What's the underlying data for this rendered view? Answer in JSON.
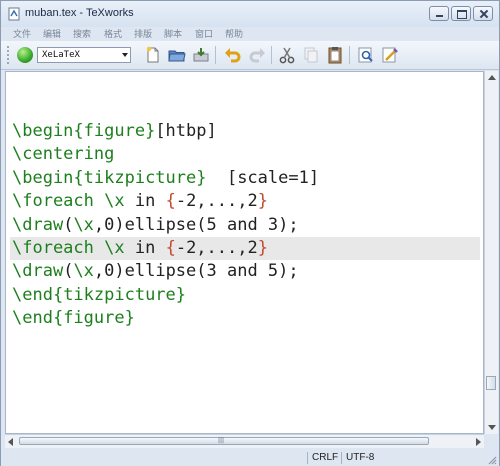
{
  "window": {
    "title": "muban.tex - TeXworks"
  },
  "menu": [
    "文件",
    "编辑",
    "搜索",
    "格式",
    "排版",
    "脚本",
    "窗口",
    "帮助"
  ],
  "toolbar": {
    "engine": "XeLaTeX",
    "icons": [
      "typeset-icon",
      "new-document-icon",
      "open-folder-icon",
      "save-icon",
      "undo-icon",
      "redo-icon",
      "cut-icon",
      "copy-icon",
      "paste-icon",
      "find-icon",
      "replace-icon"
    ]
  },
  "editor": {
    "lines": [
      [
        {
          "t": "\\begin",
          "c": "cmd"
        },
        {
          "t": "{figure}",
          "c": "arg"
        },
        {
          "t": "[htbp]",
          "c": "txt"
        }
      ],
      [
        {
          "t": "\\centering",
          "c": "cmd"
        }
      ],
      [
        {
          "t": "\\begin",
          "c": "cmd"
        },
        {
          "t": "{tikzpicture}",
          "c": "arg"
        },
        {
          "t": "  [scale=1]",
          "c": "txt"
        }
      ],
      [
        {
          "t": "\\foreach",
          "c": "cmd"
        },
        {
          "t": " ",
          "c": "txt"
        },
        {
          "t": "\\x",
          "c": "cmd"
        },
        {
          "t": " in ",
          "c": "txt"
        },
        {
          "t": "{",
          "c": "brace"
        },
        {
          "t": "-2,...,2",
          "c": "txt"
        },
        {
          "t": "}",
          "c": "brace"
        }
      ],
      [
        {
          "t": "\\draw",
          "c": "cmd"
        },
        {
          "t": "(",
          "c": "txt"
        },
        {
          "t": "\\x",
          "c": "cmd"
        },
        {
          "t": ",0)ellipse(5 and 3);",
          "c": "txt"
        }
      ],
      [
        {
          "t": "\\foreach",
          "c": "cmd"
        },
        {
          "t": " ",
          "c": "txt"
        },
        {
          "t": "\\x",
          "c": "cmd"
        },
        {
          "t": " in ",
          "c": "txt"
        },
        {
          "t": "{",
          "c": "brace"
        },
        {
          "t": "-2,...,2",
          "c": "txt"
        },
        {
          "t": "}",
          "c": "brace"
        }
      ],
      [
        {
          "t": "\\draw",
          "c": "cmd"
        },
        {
          "t": "(",
          "c": "txt"
        },
        {
          "t": "\\x",
          "c": "cmd"
        },
        {
          "t": ",0)ellipse(3 and 5);",
          "c": "txt"
        }
      ],
      [
        {
          "t": "\\end",
          "c": "cmd"
        },
        {
          "t": "{tikzpicture}",
          "c": "arg"
        }
      ],
      [
        {
          "t": "\\end",
          "c": "cmd"
        },
        {
          "t": "{figure}",
          "c": "arg"
        }
      ]
    ],
    "current_line": 5
  },
  "status": {
    "line_ending": "CRLF",
    "encoding": "UTF-8"
  },
  "colors": {
    "command": "#1d7f1d",
    "brace": "#c14a2f",
    "current_line_bg": "#e8e8e8"
  }
}
